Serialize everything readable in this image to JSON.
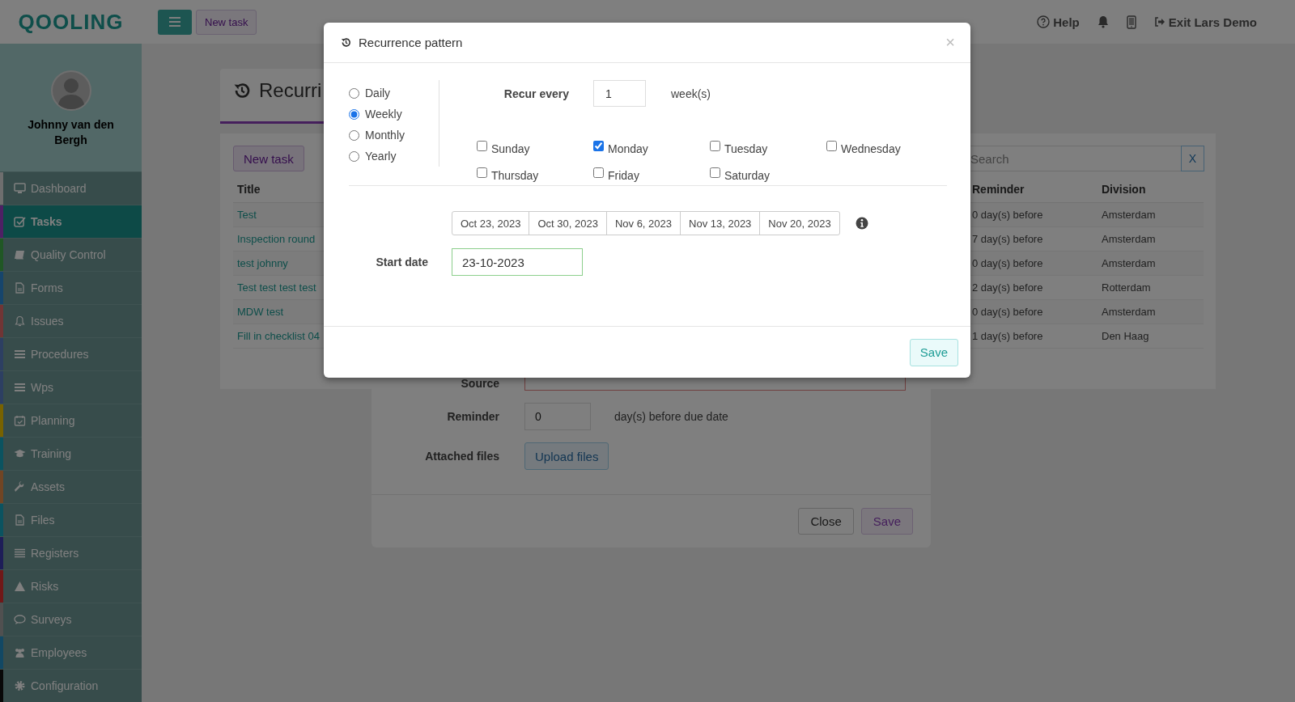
{
  "header": {
    "logo": "QOOLING",
    "new_task_button": "New task",
    "help": "Help",
    "exit": "Exit Lars Demo"
  },
  "user": {
    "name": "Johnny van den Bergh"
  },
  "sidebar": {
    "items": [
      {
        "label": "Dashboard",
        "color": "#6e6e6e",
        "selected": false
      },
      {
        "label": "Tasks",
        "color": "#4e2064",
        "selected": true
      },
      {
        "label": "Quality Control",
        "color": "#205725",
        "selected": false
      },
      {
        "label": "Forms",
        "color": "#16456c",
        "selected": false
      },
      {
        "label": "Issues",
        "color": "#703535",
        "selected": false
      },
      {
        "label": "Procedures",
        "color": "#2d3f62",
        "selected": false
      },
      {
        "label": "Wps",
        "color": "#2d3f62",
        "selected": false
      },
      {
        "label": "Planning",
        "color": "#786200",
        "selected": false
      },
      {
        "label": "Training",
        "color": "#0b5360",
        "selected": false
      },
      {
        "label": "Assets",
        "color": "#704524",
        "selected": false
      },
      {
        "label": "Files",
        "color": "#0b5360",
        "selected": false
      },
      {
        "label": "Registers",
        "color": "#1e1e58",
        "selected": false
      },
      {
        "label": "Risks",
        "color": "#701818",
        "selected": false
      },
      {
        "label": "Surveys",
        "color": "#505050",
        "selected": false
      },
      {
        "label": "Employees",
        "color": "#124864",
        "selected": false
      },
      {
        "label": "Configuration",
        "color": "#080808",
        "selected": false
      }
    ]
  },
  "page": {
    "title": "Recurri",
    "new_task_button": "New task",
    "search": {
      "placeholder": "Search",
      "clear": "X"
    },
    "table": {
      "columns": [
        "Title",
        "Reminder",
        "Division"
      ],
      "rows": [
        {
          "title": "Test",
          "reminder": "0 day(s) before",
          "division": "Amsterdam"
        },
        {
          "title": "Inspection round",
          "reminder": "7 day(s) before",
          "division": "Amsterdam"
        },
        {
          "title": "test johnny",
          "reminder": "0 day(s) before",
          "division": "Amsterdam"
        },
        {
          "title": "Test test test test",
          "reminder": "2 day(s) before",
          "division": "Rotterdam"
        },
        {
          "title": "MDW test",
          "reminder": "0 day(s) before",
          "division": "Amsterdam"
        },
        {
          "title": "Fill in checklist 04",
          "reminder": "1 day(s) before",
          "division": "Den Haag"
        }
      ]
    }
  },
  "task_form": {
    "source": {
      "label": "Source",
      "invalid": true
    },
    "reminder": {
      "label": "Reminder",
      "value": "0",
      "suffix": "day(s) before due date"
    },
    "attachments": {
      "label": "Attached files",
      "button": "Upload files"
    },
    "buttons": [
      {
        "label": "Close",
        "kind": "default"
      },
      {
        "label": "Save",
        "kind": "primary"
      }
    ]
  },
  "recurrence_dialog": {
    "title": "Recurrence pattern",
    "close": "×",
    "patterns": [
      {
        "label": "Daily",
        "selected": false
      },
      {
        "label": "Weekly",
        "selected": true
      },
      {
        "label": "Monthly",
        "selected": false
      },
      {
        "label": "Yearly",
        "selected": false
      }
    ],
    "recur_every": {
      "label": "Recur every",
      "value": "1",
      "unit": "week(s)"
    },
    "days": [
      {
        "label": "Sunday",
        "checked": false
      },
      {
        "label": "Monday",
        "checked": true
      },
      {
        "label": "Tuesday",
        "checked": false
      },
      {
        "label": "Wednesday",
        "checked": false
      },
      {
        "label": "Thursday",
        "checked": false
      },
      {
        "label": "Friday",
        "checked": false
      },
      {
        "label": "Saturday",
        "checked": false
      }
    ],
    "preview_dates": [
      "Oct 23, 2023",
      "Oct 30, 2023",
      "Nov 6, 2023",
      "Nov 13, 2023",
      "Nov 20, 2023"
    ],
    "start_date": {
      "label": "Start date",
      "value": "23-10-2023"
    },
    "save_button": "Save"
  }
}
